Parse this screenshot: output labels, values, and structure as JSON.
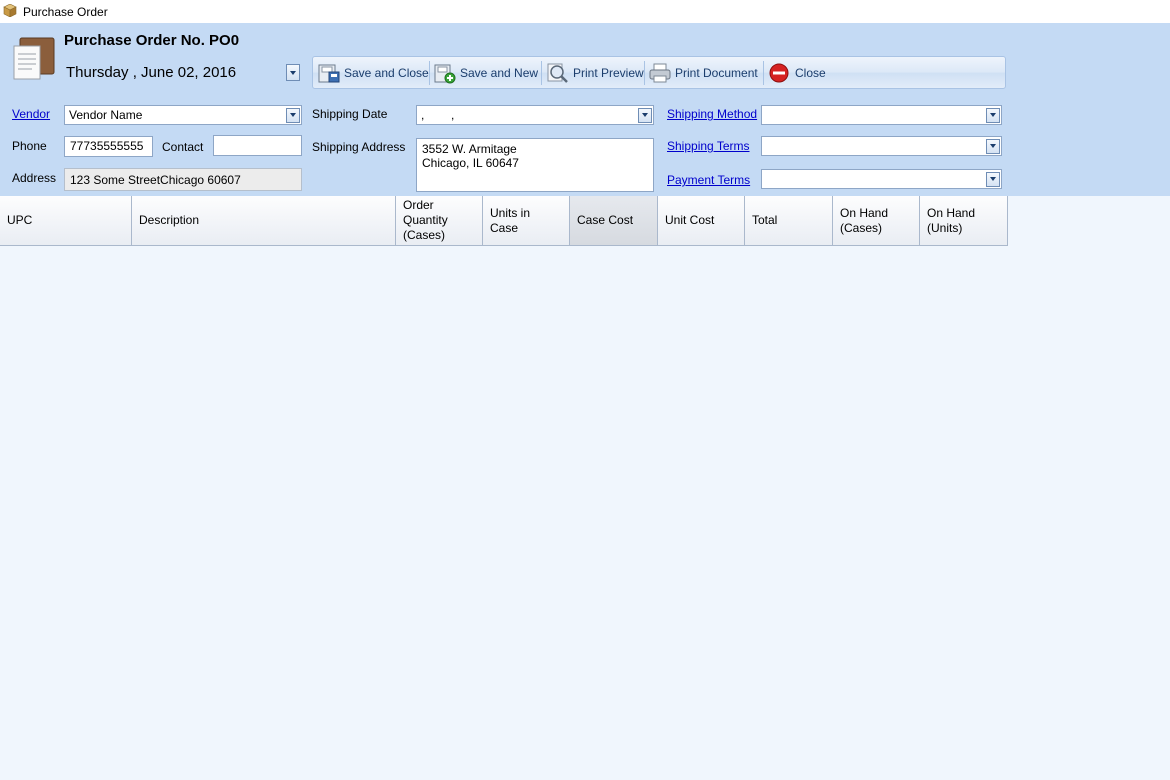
{
  "window": {
    "title": "Purchase Order"
  },
  "header": {
    "po_title": "Purchase Order No. PO0",
    "date": "Thursday ,  June  02,  2016"
  },
  "toolbar": {
    "save_close": "Save and Close",
    "save_new": "Save and New",
    "print_preview": "Print Preview",
    "print_document": "Print Document",
    "close": "Close"
  },
  "form": {
    "vendor_label": "Vendor",
    "vendor_value": "Vendor Name",
    "phone_label": "Phone",
    "phone_value": "77735555555",
    "contact_label": "Contact",
    "contact_value": "",
    "address_label": "Address",
    "address_value": "123 Some StreetChicago 60607",
    "shipping_date_label": "Shipping Date",
    "shipping_date_value": ",        ,",
    "shipping_address_label": "Shipping Address",
    "shipping_address_value": "3552 W. Armitage\nChicago, IL 60647",
    "shipping_method_label": "Shipping Method",
    "shipping_method_value": "",
    "shipping_terms_label": "Shipping Terms",
    "shipping_terms_value": "",
    "payment_terms_label": "Payment Terms",
    "payment_terms_value": ""
  },
  "grid": {
    "columns": [
      "UPC",
      "Description",
      "Order\nQuantity\n(Cases)",
      "Units in\nCase",
      "Case Cost",
      "Unit Cost",
      "Total",
      "On Hand\n(Cases)",
      "On Hand\n(Units)"
    ]
  },
  "colors": {
    "form_bg": "#c4daf4",
    "grid_bg": "#f0f6fd",
    "link": "#0000cc",
    "close_red": "#d62222"
  }
}
